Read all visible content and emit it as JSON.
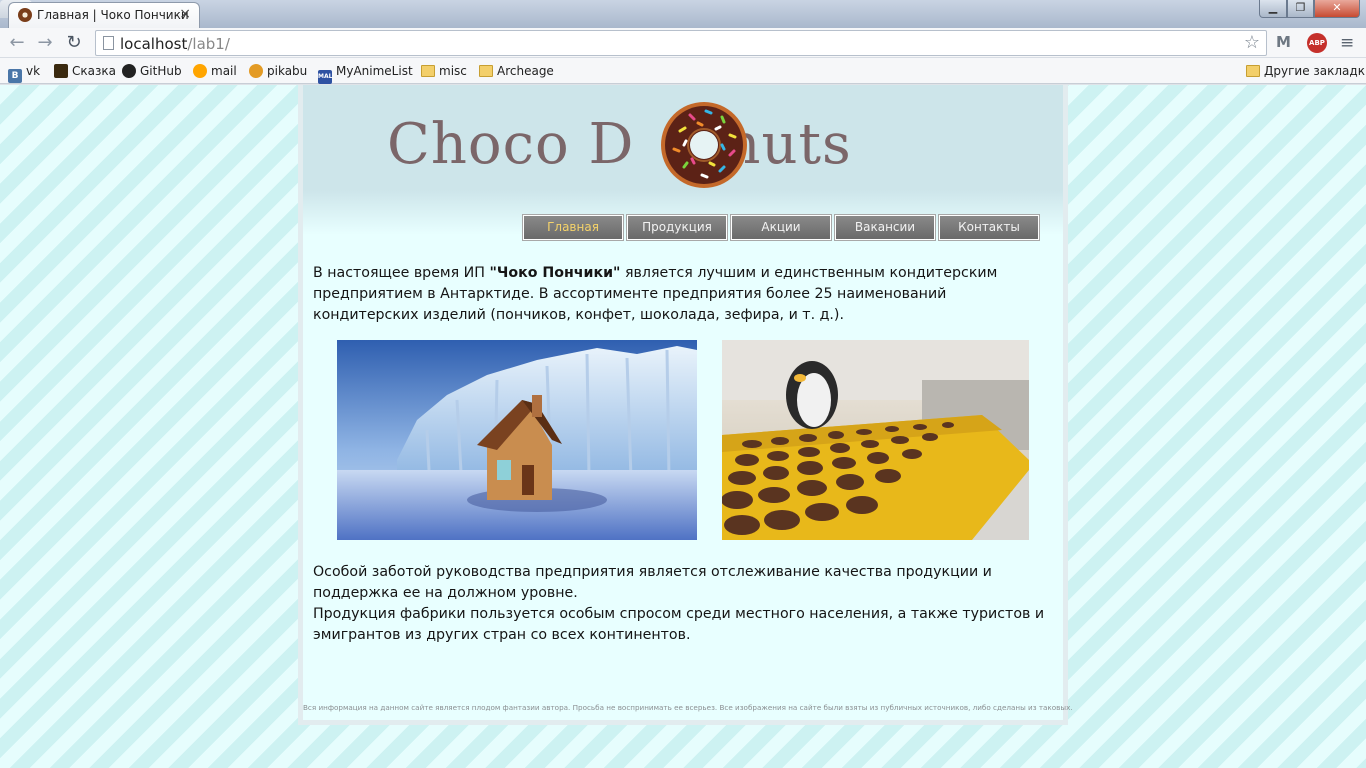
{
  "browser": {
    "tab_title": "Главная | Чоко Пончики",
    "url_host": "localhost",
    "url_path": "/lab1/",
    "window_controls": [
      "minimize",
      "maximize",
      "close"
    ],
    "extensions": [
      "gmail-checker-icon",
      "adblock-plus-icon"
    ],
    "abp_label": "ABP",
    "bookmarks": [
      {
        "label": "vk",
        "icon": "vk-icon",
        "badge": "B"
      },
      {
        "label": "Сказка",
        "icon": "skazka-icon"
      },
      {
        "label": "GitHub",
        "icon": "github-icon"
      },
      {
        "label": "mail",
        "icon": "mail-ru-icon"
      },
      {
        "label": "pikabu",
        "icon": "pikabu-icon"
      },
      {
        "label": "MyAnimeList",
        "icon": "myanimelist-icon",
        "badge": "MAL"
      },
      {
        "label": "misc",
        "icon": "folder-icon"
      },
      {
        "label": "Archeage",
        "icon": "folder-icon"
      }
    ],
    "other_bookmarks": "Другие закладки"
  },
  "site": {
    "logo_left": "Choco D",
    "logo_right": "nuts",
    "nav": [
      {
        "label": "Главная",
        "active": true
      },
      {
        "label": "Продукция",
        "active": false
      },
      {
        "label": "Акции",
        "active": false
      },
      {
        "label": "Вакансии",
        "active": false
      },
      {
        "label": "Контакты",
        "active": false
      }
    ],
    "intro_before": "В настоящее время ИП ",
    "intro_brand": "\"Чоко Пончики\"",
    "intro_after": " является лучшим и единственным кондитерским предприятием в Антарктиде. В ассортименте предприятия более 25 наименований кондитерских изделий (пончиков, конфет, шоколада, зефира, и т. д.).",
    "images": [
      {
        "name": "gingerbread-house-antarctica-photo"
      },
      {
        "name": "penguin-chocolate-factory-photo"
      }
    ],
    "quality_text": "Особой заботой руководства предприятия является отслеживание качества продукции и поддержка ее на должном уровне.",
    "demand_text": "Продукция фабрики пользуется особым спросом среди местного населения, а также туристов и эмигрантов из других стран со всех континентов.",
    "footer": "Вся информация на данном сайте является плодом фантазии автора. Просьба не воспринимать ее всерьез. Все изображения на сайте были взяты из публичных источников, либо сделаны из таковых."
  },
  "colors": {
    "page_stripe_light": "#e6fdfd",
    "page_stripe_dark": "#cdf2f2",
    "logo_text": "#7b6669",
    "nav_bg": "#7a7a7a",
    "nav_active_text": "#f5d36a",
    "donut_glaze": "#5c2216",
    "donut_dough": "#c4692a"
  }
}
